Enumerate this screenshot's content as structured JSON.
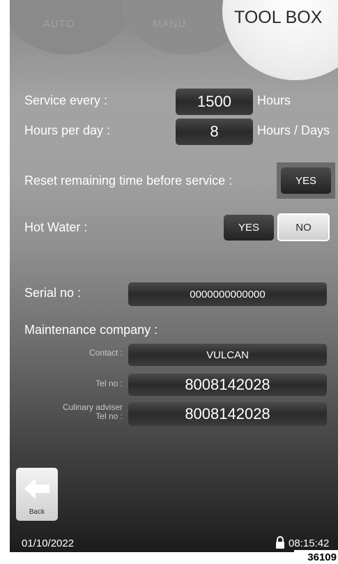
{
  "tabs": {
    "auto_label": "AUTO",
    "manu_label": "MANU",
    "toolbox_label": "TOOL BOX"
  },
  "service": {
    "service_every_label": "Service every :",
    "service_every_value": "1500",
    "service_every_unit": "Hours",
    "hours_per_day_label": "Hours per day :",
    "hours_per_day_value": "8",
    "hours_per_day_unit": "Hours / Days"
  },
  "reset": {
    "label": "Reset remaining time before service :",
    "yes_label": "YES"
  },
  "hot_water": {
    "label": "Hot Water :",
    "yes_label": "YES",
    "no_label": "NO"
  },
  "serial": {
    "label": "Serial no :",
    "value": "0000000000000"
  },
  "maintenance": {
    "label": "Maintenance company :",
    "contact_label": "Contact :",
    "contact_value": "VULCAN",
    "tel_label": "Tel no :",
    "tel_value": "8008142028",
    "culinary_label_line1": "Culinary adviser",
    "culinary_label_line2": "Tel no :",
    "culinary_value": "8008142028"
  },
  "back": {
    "label": "Back"
  },
  "footer": {
    "date": "01/10/2022",
    "time": "08:15:42"
  },
  "figure_ref": "36109",
  "icons": {
    "back": "arrow-left-icon",
    "lock": "lock-icon"
  }
}
